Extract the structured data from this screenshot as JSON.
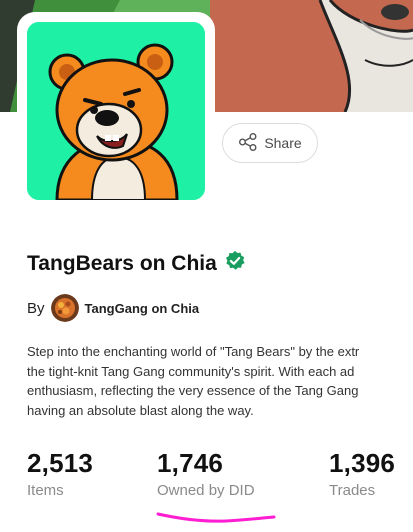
{
  "collection": {
    "title": "TangBears on Chia",
    "verified_icon": "verified-check-icon",
    "verified_color": "#1a9e5f",
    "by_label": "By",
    "creator_name": "TangGang on Chia"
  },
  "actions": {
    "share_label": "Share",
    "share_icon": "share-icon"
  },
  "description": {
    "lines": [
      "Step into the enchanting world of \"Tang Bears\" by the extr",
      "the tight-knit Tang Gang community's spirit. With each ad",
      "enthusiasm, reflecting the very essence of the Tang Gang",
      "having an absolute blast along the way."
    ]
  },
  "stats": [
    {
      "value": "2,513",
      "label": "Items"
    },
    {
      "value": "1,746",
      "label": "Owned by DID"
    },
    {
      "value": "1,396",
      "label": "Trades"
    }
  ],
  "colors": {
    "avatar_background": "#1ef0a6",
    "bear_orange": "#f58a1f",
    "annotation_scribble": "#ff1dd2"
  }
}
